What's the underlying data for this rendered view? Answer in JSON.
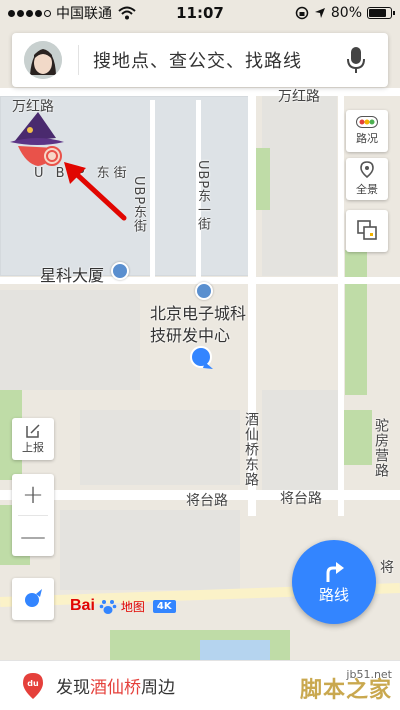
{
  "status_bar": {
    "carrier": "中国联通",
    "time": "11:07",
    "battery": "80%",
    "battery_level": 0.8,
    "signal_bars": 4
  },
  "search": {
    "placeholder": "搜地点、查公交、找路线"
  },
  "map": {
    "labels": {
      "wanhong_left": "万红路",
      "wanhong_right": "万红路",
      "ubp_left": "U B P 东街",
      "ubp_east": "UBP东街",
      "ubp_east1": "UBP东一街",
      "xingke": "星科大厦",
      "beijing_center": "北京电子城科技研发中心",
      "jiuxianqiao_east": "酒仙桥东路",
      "jiangtai_left": "将台路",
      "jiangtai_right": "将台路",
      "tuofang": "驼房营路",
      "jiang": "将"
    }
  },
  "controls": {
    "traffic_label": "路况",
    "panorama_label": "全景",
    "report_label": "上报",
    "zoom_in": "+",
    "zoom_out": "—",
    "route_label": "路线"
  },
  "logo": {
    "bai": "Bai",
    "map_text": "地图",
    "badge": "4K"
  },
  "bottom": {
    "prefix": "发现",
    "highlight": "酒仙桥",
    "suffix": "周边",
    "highlight_color": "#e5403b"
  },
  "watermark": {
    "site": "jb51.net",
    "name": "脚本之家"
  },
  "colors": {
    "accent": "#3385ff",
    "brand_red": "#e10601"
  },
  "icons": [
    "signal-icon",
    "wifi-icon",
    "lock-rotation-icon",
    "location-arrow-icon",
    "battery-icon",
    "mic-icon",
    "traffic-icon",
    "panorama-icon",
    "layers-icon",
    "report-icon",
    "compass-icon",
    "route-arrow-icon",
    "pin-icon",
    "building-icon",
    "witch-mascot-icon",
    "red-arrow-annotation"
  ]
}
